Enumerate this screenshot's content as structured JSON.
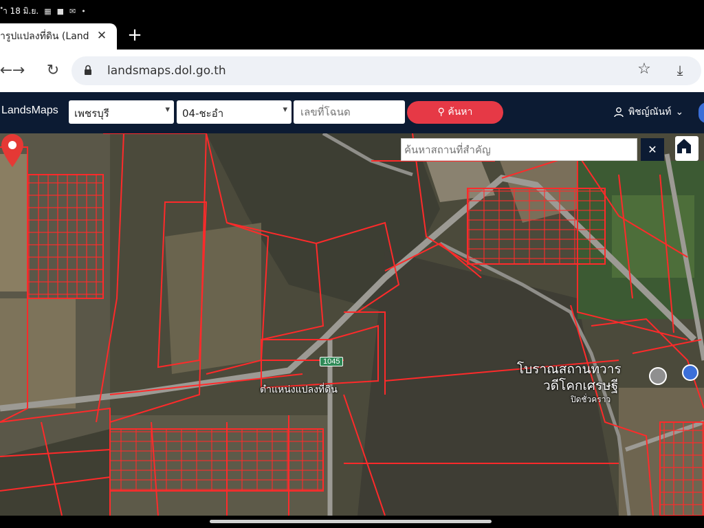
{
  "status_bar": {
    "time_date": "ำ 18 มิ.ย.",
    "notif_icons": [
      "calendar-icon",
      "facebook-icon",
      "mail-icon"
    ],
    "dot": "•"
  },
  "tab": {
    "title": "ารูปแปลงที่ดิน (Land",
    "close": "✕",
    "new_tab": "+"
  },
  "toolbar": {
    "back": "←",
    "forward": "→",
    "reload": "↻",
    "url": "landsmaps.dol.go.th",
    "star": "☆",
    "download": "⤓"
  },
  "app": {
    "brand": "LandsMaps",
    "province": "เพชรบุรี",
    "district": "04-ชะอำ",
    "parcel_placeholder": "เลขที่โฉนด",
    "search_button": "ค้นหา",
    "user_name": "พิชญ์ณันท์",
    "caret": "⌄",
    "colors": {
      "header_bg": "#0c1b33",
      "search_red": "#e63946",
      "parcel_line": "#ff2a2a"
    }
  },
  "map": {
    "place_search_placeholder": "ค้นหาสถานที่สำคัญ",
    "clear": "✕",
    "home_icon": "home-icon",
    "route_number": "1045",
    "pin_label": "ตำแหน่งแปลงที่ดิน",
    "poi_line1": "โบราณสถานทวาร",
    "poi_line2": "วดีโคกเศรษฐี",
    "poi_line3": "ปิดชั่วคราว"
  }
}
